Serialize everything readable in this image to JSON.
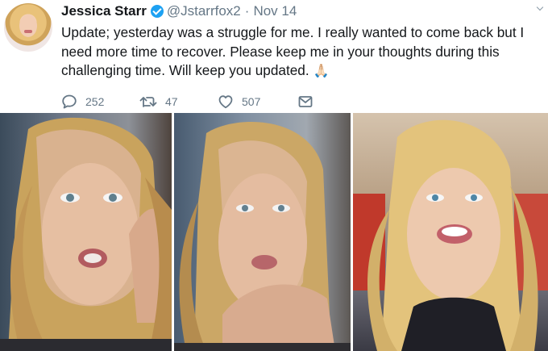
{
  "tweet": {
    "author_name": "Jessica Starr",
    "handle": "@Jstarrfox2",
    "separator": "·",
    "date": "Nov 14",
    "text": "Update; yesterday was a struggle for me. I really wanted to come back but I need more time to recover. Please keep me in your thoughts during this challenging time. Will keep you updated.",
    "emoji": "🙏🏻"
  },
  "actions": {
    "replies": "252",
    "retweets": "47",
    "likes": "507"
  },
  "icons": {
    "reply": "reply-icon",
    "retweet": "retweet-icon",
    "like": "heart-icon",
    "dm": "envelope-icon",
    "verified": "verified-badge-icon",
    "caret": "chevron-down-icon"
  },
  "colors": {
    "verified": "#1da1f2",
    "muted": "#657786",
    "text": "#14171a"
  }
}
